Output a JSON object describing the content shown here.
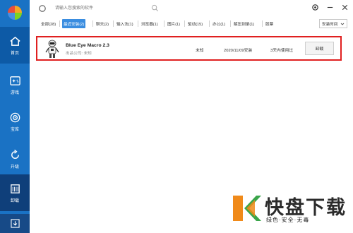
{
  "sidebar": {
    "logo_icon": "pinwheel-logo-icon",
    "items": [
      {
        "label": "首页",
        "icon": "home-icon"
      },
      {
        "label": "游戏",
        "icon": "gamepad-icon"
      },
      {
        "label": "宝库",
        "icon": "treasure-icon"
      },
      {
        "label": "升级",
        "icon": "upgrade-icon"
      },
      {
        "label": "卸载",
        "icon": "uninstall-icon"
      }
    ],
    "bottom_icon": "download-icon"
  },
  "search": {
    "placeholder": "请输入您搜索的软件"
  },
  "window_controls": [
    "gear-icon",
    "minimize-icon",
    "close-icon"
  ],
  "tabs": [
    "全部(28)",
    "最近安装(2)",
    "聊天(2)",
    "输入法(1)",
    "浏览器(1)",
    "图片(1)",
    "驱动(15)",
    "办公(1)",
    "解压刻录(1)",
    "股票"
  ],
  "sort": {
    "label": "安装时间"
  },
  "app": {
    "name": "Blue Eye Macro 2.3",
    "publisher": "出品公司: 未知",
    "size": "未知",
    "install_date": "2020/11/09安装",
    "last_used": "3天内使用过",
    "uninstall_label": "卸载"
  },
  "watermark": {
    "title": "快盘下载",
    "subtitle": "绿色·安全·无毒"
  },
  "colors": {
    "sidebar": "#1a72c4",
    "active_tab": "#3a8de0",
    "highlight": "#e02020",
    "watermark_orange": "#f08a1a",
    "watermark_green": "#3aa54a"
  }
}
